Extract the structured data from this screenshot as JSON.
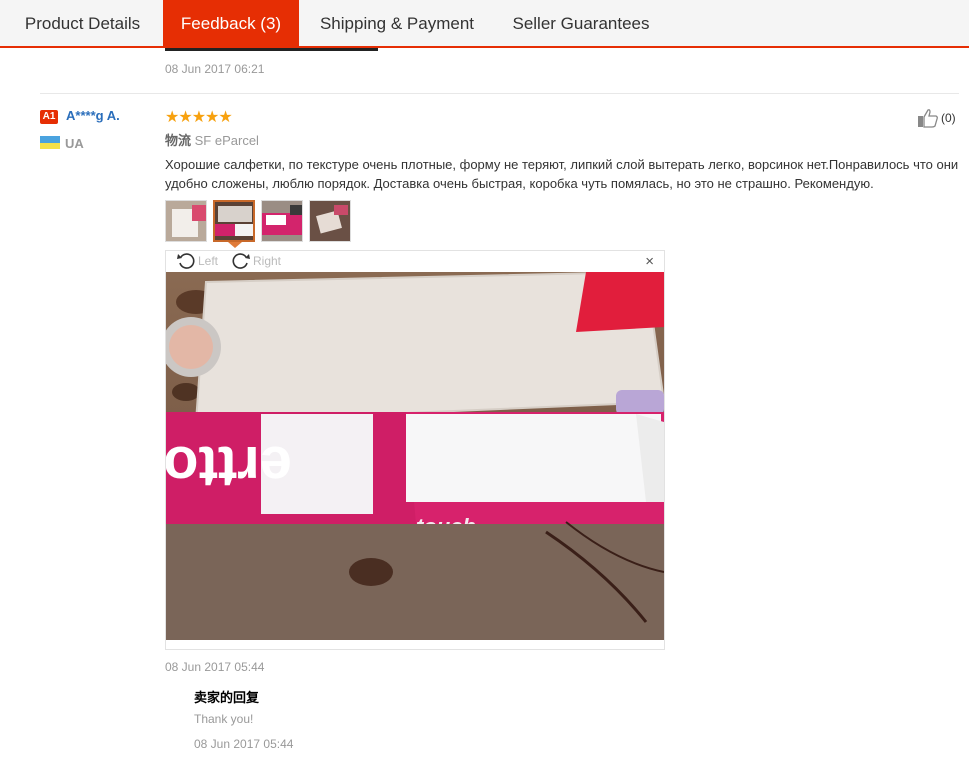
{
  "tabs": [
    {
      "label": "Product Details",
      "active": false
    },
    {
      "label": "Feedback (3)",
      "active": true
    },
    {
      "label": "Shipping & Payment",
      "active": false
    },
    {
      "label": "Seller Guarantees",
      "active": false
    }
  ],
  "previous_feedback": {
    "date": "08 Jun 2017 06:21"
  },
  "feedback": {
    "user": {
      "level_badge": "A1",
      "name": "A****g A.",
      "country": "UA"
    },
    "rating_stars": 5,
    "stars_text": "★★★★★",
    "logistics_label": "物流",
    "logistics_value": "SF eParcel",
    "helpful_count": "(0)",
    "text": "Хорошие салфетки, по текстуре очень плотные, форму не теряют, липкий слой вытерать легко, ворсинок нет.Понравилось что они удобно сложены, люблю порядок. Доставка очень быстрая, коробка чуть помялась, но это не страшно. Рекомендую.",
    "date": "08 Jun 2017 05:44",
    "viewer": {
      "rotate_left": "Left",
      "rotate_right": "Right",
      "close": "×"
    },
    "seller_reply": {
      "title": "卖家的回复",
      "text": "Thank you!",
      "date": "08 Jun 2017 05:44"
    }
  },
  "colors": {
    "accent": "#e62e04",
    "stars": "#f7a10f",
    "username": "#2a6ebb"
  }
}
